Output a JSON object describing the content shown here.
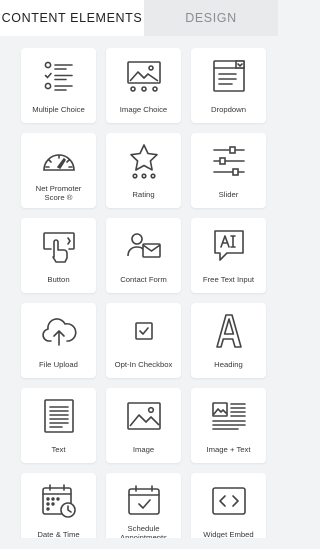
{
  "tabs": {
    "content": "CONTENT ELEMENTS",
    "design": "DESIGN"
  },
  "elements": [
    {
      "label": "Multiple Choice",
      "icon": "multiple-choice-icon"
    },
    {
      "label": "Image Choice",
      "icon": "image-choice-icon"
    },
    {
      "label": "Dropdown",
      "icon": "dropdown-icon"
    },
    {
      "label": "Net Promoter\nScore ®",
      "icon": "gauge-icon"
    },
    {
      "label": "Rating",
      "icon": "star-rating-icon"
    },
    {
      "label": "Slider",
      "icon": "slider-icon"
    },
    {
      "label": "Button",
      "icon": "button-click-icon"
    },
    {
      "label": "Contact Form",
      "icon": "contact-form-icon"
    },
    {
      "label": "Free Text Input",
      "icon": "text-input-icon"
    },
    {
      "label": "File Upload",
      "icon": "cloud-upload-icon"
    },
    {
      "label": "Opt-In Checkbox",
      "icon": "checkbox-icon"
    },
    {
      "label": "Heading",
      "icon": "heading-icon"
    },
    {
      "label": "Text",
      "icon": "text-block-icon"
    },
    {
      "label": "Image",
      "icon": "image-icon"
    },
    {
      "label": "Image + Text",
      "icon": "image-text-icon"
    },
    {
      "label": "Date & Time",
      "icon": "calendar-icon"
    },
    {
      "label": "Schedule\nAppointments",
      "icon": "schedule-icon"
    },
    {
      "label": "Widget Embed",
      "icon": "code-embed-icon"
    }
  ]
}
